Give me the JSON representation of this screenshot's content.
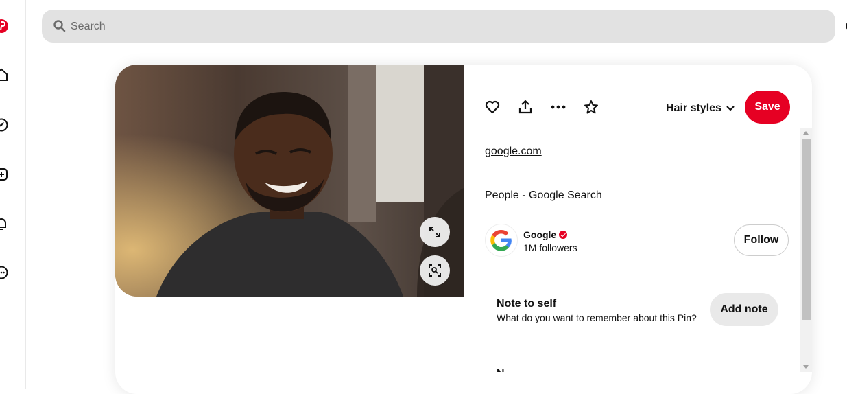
{
  "sidebar": {
    "items": [
      {
        "name": "pinterest-logo-icon"
      },
      {
        "name": "home-icon"
      },
      {
        "name": "explore-icon"
      },
      {
        "name": "create-icon"
      },
      {
        "name": "notifications-icon"
      },
      {
        "name": "messages-icon"
      }
    ]
  },
  "search": {
    "placeholder": "Search"
  },
  "pin": {
    "board_name": "Hair styles",
    "save_label": "Save",
    "link_text": "google.com",
    "title": "People - Google Search",
    "creator": {
      "name": "Google",
      "followers": "1M followers",
      "follow_label": "Follow"
    },
    "note": {
      "title": "Note to self",
      "subtitle": "What do you want to remember about this Pin?",
      "button_label": "Add note"
    },
    "cut_off_text": "N"
  },
  "colors": {
    "brand_red": "#e60023",
    "search_bg": "#e2e2e2",
    "add_note_bg": "#e9e9e9"
  }
}
